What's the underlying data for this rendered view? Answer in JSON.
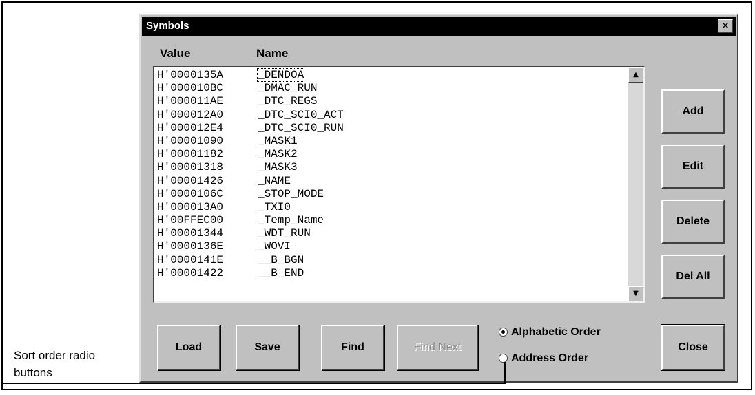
{
  "dialog": {
    "title": "Symbols",
    "close_glyph": "✕",
    "columns": {
      "value": "Value",
      "name": "Name"
    },
    "symbols": [
      {
        "value": "H'0000135A",
        "name": "_DENDOA"
      },
      {
        "value": "H'000010BC",
        "name": "_DMAC_RUN"
      },
      {
        "value": "H'000011AE",
        "name": "_DTC_REGS"
      },
      {
        "value": "H'000012A0",
        "name": "_DTC_SCI0_ACT"
      },
      {
        "value": "H'000012E4",
        "name": "_DTC_SCI0_RUN"
      },
      {
        "value": "H'00001090",
        "name": "_MASK1"
      },
      {
        "value": "H'00001182",
        "name": "_MASK2"
      },
      {
        "value": "H'00001318",
        "name": "_MASK3"
      },
      {
        "value": "H'00001426",
        "name": "_NAME"
      },
      {
        "value": "H'0000106C",
        "name": "_STOP_MODE"
      },
      {
        "value": "H'000013A0",
        "name": "_TXI0"
      },
      {
        "value": "H'00FFEC00",
        "name": "_Temp_Name"
      },
      {
        "value": "H'00001344",
        "name": "_WDT_RUN"
      },
      {
        "value": "H'0000136E",
        "name": "_WOVI"
      },
      {
        "value": "H'0000141E",
        "name": "__B_BGN"
      },
      {
        "value": "H'00001422",
        "name": "__B_END"
      }
    ],
    "selected_index": 0,
    "scroll_up_glyph": "▲",
    "scroll_down_glyph": "▼",
    "buttons": {
      "add": "Add",
      "edit": "Edit",
      "delete": "Delete",
      "del_all": "Del All",
      "load": "Load",
      "save": "Save",
      "find": "Find",
      "find_next": "Find Next",
      "close": "Close"
    },
    "sort_order": {
      "options": [
        "Alphabetic Order",
        "Address Order"
      ],
      "selected": "Alphabetic Order"
    }
  },
  "annotation": {
    "line1": "Sort order radio",
    "line2": "buttons"
  },
  "colors": {
    "dialog_face": "#c0c0c0",
    "titlebar": "#000000",
    "disabled_text": "#8a8a8a"
  }
}
